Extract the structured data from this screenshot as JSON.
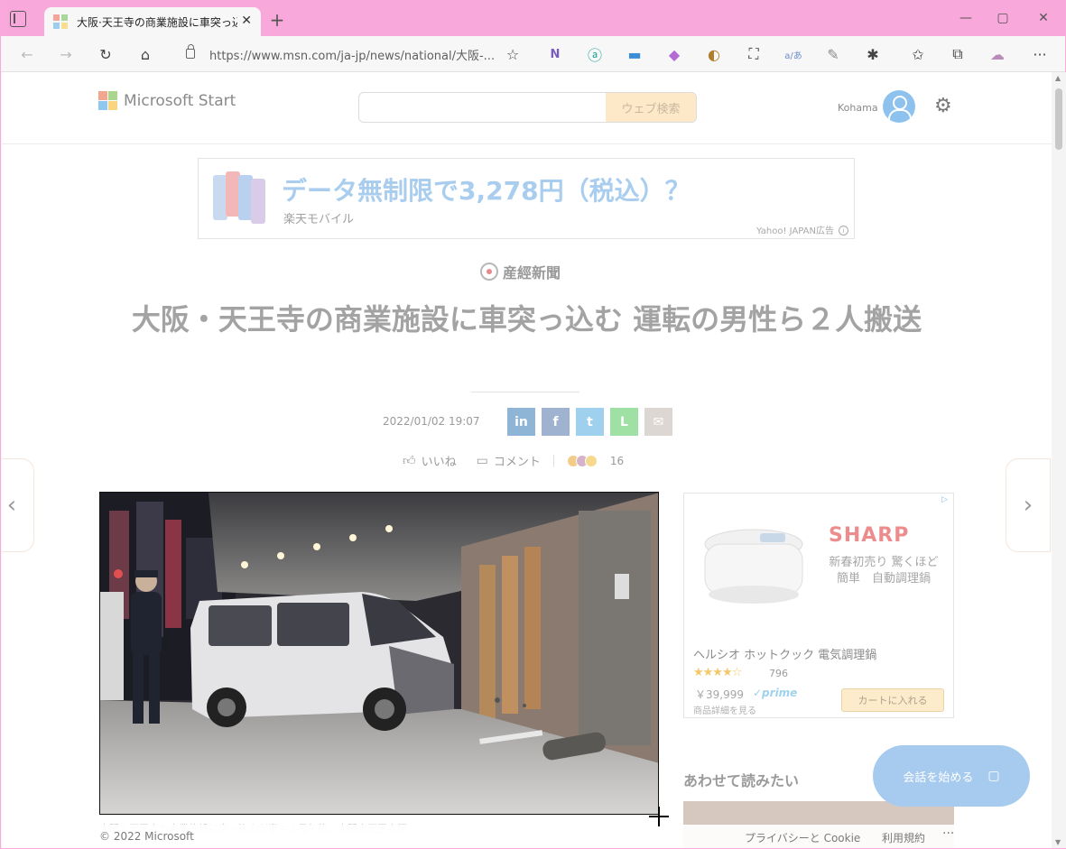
{
  "browser": {
    "tab_title": "大阪·天王寺の商業施設に車突っ込",
    "url": "https://www.msn.com/ja-jp/news/national/大阪-...",
    "close_tab_label": "✕",
    "new_tab_label": "+"
  },
  "header": {
    "logo_text": "Microsoft Start",
    "search_placeholder": "",
    "search_button": "ウェブ検索",
    "user_name": "Kohama"
  },
  "top_ad": {
    "headline": "データ無制限で3,278円（税込）？",
    "advertiser": "楽天モバイル",
    "label": "Yahoo! JAPAN広告"
  },
  "article": {
    "publisher": "産經新聞",
    "headline": "大阪・天王寺の商業施設に車突っ込む 運転の男性ら２人搬送",
    "date": "2022/01/02 19:07",
    "like_label": "いいね",
    "comment_label": "コメント",
    "reaction_count": "16",
    "caption": "大阪・天王寺の商業施設に突っ込んだ車＝２日午後、大阪市天王寺区"
  },
  "share": {
    "linkedin": "in",
    "facebook": "f",
    "twitter": "t",
    "line": "L",
    "email": "✉"
  },
  "side_ad": {
    "brand": "SHARP",
    "copy": "新春初売り 驚くほど簡単　自動調理鍋",
    "product": "ヘルシオ ホットクック 電気調理鍋",
    "stars": "★★★★☆",
    "rating_count": "796",
    "price": "￥39,999",
    "prime": "✓prime",
    "detail_link": "商品詳細を見る",
    "cart_button": "カートに入れる"
  },
  "related": {
    "heading": "あわせて読みたい"
  },
  "chat": {
    "label": "会話を始める"
  },
  "footer": {
    "copyright": "© 2022 Microsoft",
    "privacy": "プライバシーと Cookie",
    "terms": "利用規約",
    "more": "···"
  },
  "colors": {
    "accent": "#a7cbee",
    "tab_bar": "#f9a8db",
    "linkedin": "#8fb5d6",
    "facebook": "#9fb2cf",
    "twitter": "#9fd0ee",
    "line": "#9fe0a4",
    "email": "#ddd7d3"
  }
}
